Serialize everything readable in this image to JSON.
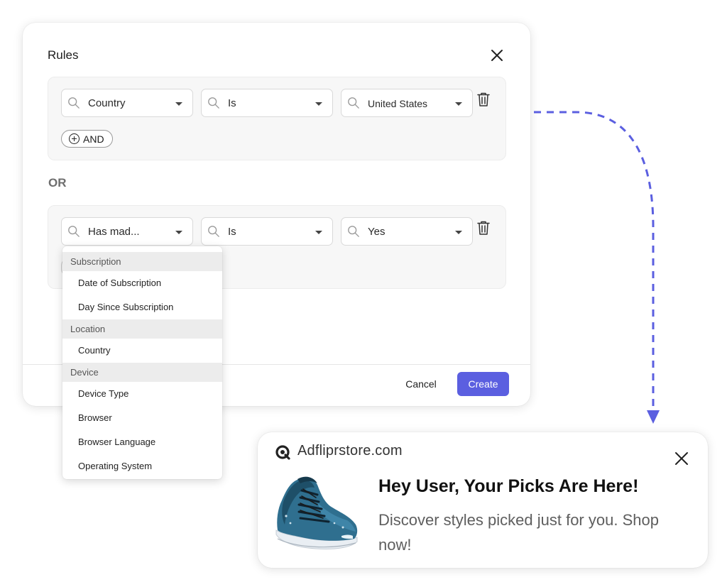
{
  "modal": {
    "title": "Rules",
    "groups": [
      {
        "fields": [
          "Country",
          "Is",
          "United States"
        ],
        "and_label": "AND"
      },
      {
        "fields": [
          "Has mad...",
          "Is",
          "Yes"
        ]
      }
    ],
    "or_label": "OR",
    "cancel_label": "Cancel",
    "create_label": "Create"
  },
  "dropdown": {
    "sections": [
      {
        "header": "Subscription",
        "items": [
          "Date of Subscription",
          "Day Since Subscription"
        ]
      },
      {
        "header": "Location",
        "items": [
          "Country"
        ]
      },
      {
        "header": "Device",
        "items": [
          "Device Type",
          "Browser",
          "Browser Language",
          "Operating System"
        ]
      }
    ]
  },
  "notification": {
    "brand": "Adfliprstore.com",
    "title": "Hey User, Your Picks Are Here!",
    "body": "Discover styles picked just for you. Shop now!"
  },
  "colors": {
    "accent": "#5b5fe0",
    "connector": "#5b5fe0"
  }
}
